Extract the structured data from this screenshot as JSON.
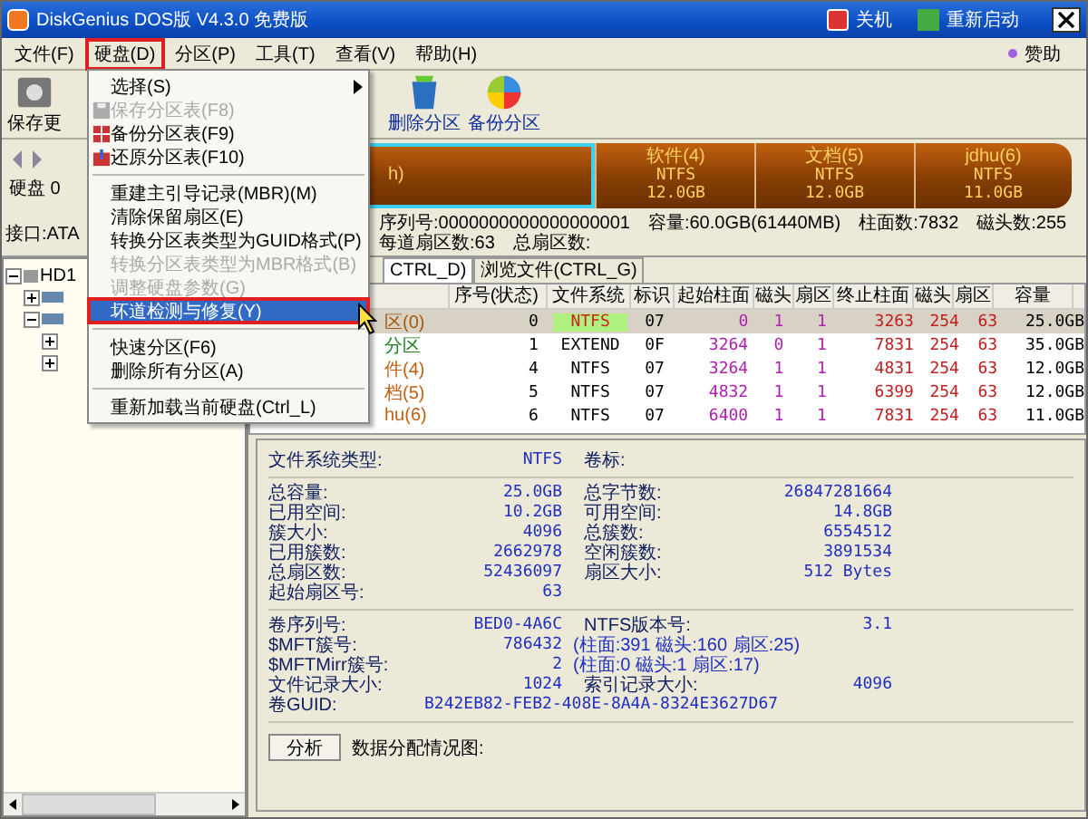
{
  "window": {
    "title": "DiskGenius DOS版 V4.3.0 免费版",
    "actions": [
      "关机",
      "重新启动"
    ]
  },
  "menu_bar": {
    "items": [
      {
        "label": "文件(F)",
        "selected": false
      },
      {
        "label": "硬盘(D)",
        "selected": true
      },
      {
        "label": "分区(P)",
        "selected": false
      },
      {
        "label": "工具(T)",
        "selected": false
      },
      {
        "label": "查看(V)",
        "selected": false
      },
      {
        "label": "帮助(H)",
        "selected": false
      }
    ],
    "sponsor": "赞助"
  },
  "toolbar": {
    "left_button": "保存更",
    "buttons": [
      "删除分区",
      "备份分区"
    ]
  },
  "disk_panel": {
    "label": "硬盘 0",
    "partitions": [
      {
        "name": "h)",
        "selected": true
      },
      {
        "name": "软件(4)",
        "fs": "NTFS",
        "size": "12.0GB",
        "selected": false
      },
      {
        "name": "文档(5)",
        "fs": "NTFS",
        "size": "12.0GB",
        "selected": false
      },
      {
        "name": "jdhu(6)",
        "fs": "NTFS",
        "size": "11.0GB",
        "selected": false
      }
    ]
  },
  "info_line": [
    "接口:ATA",
    "序列号:0000000000000000001",
    "容量:60.0GB(61440MB)",
    "柱面数:7832",
    "磁头数:255",
    "每道扇区数:63",
    "总扇区数:"
  ],
  "tree": [
    {
      "label": "HD1",
      "expanded": true,
      "children": [
        {
          "expanded": false
        },
        {
          "expanded": true,
          "children": [
            {
              "expanded": false
            },
            {
              "expanded": false
            }
          ]
        }
      ]
    }
  ],
  "tabs": [
    {
      "label": "CTRL_D)",
      "selected": true
    },
    {
      "label": "浏览文件(CTRL_G)",
      "selected": false
    }
  ],
  "table": {
    "columns": [
      "",
      "序号(状态)",
      "文件系统",
      "标识",
      "起始柱面",
      "磁头",
      "扇区",
      "终止柱面",
      "磁头",
      "扇区",
      "容量"
    ],
    "rows": [
      {
        "selected": true,
        "color": "#a05a10",
        "cells": [
          "区(0)",
          "0",
          "NTFS",
          "07",
          "0",
          "1",
          "1",
          "3263",
          "254",
          "63",
          "25.0GB"
        ]
      },
      {
        "selected": false,
        "color": "#208020",
        "cells": [
          "分区",
          "1",
          "EXTEND",
          "0F",
          "3264",
          "0",
          "1",
          "7831",
          "254",
          "63",
          "35.0GB"
        ]
      },
      {
        "selected": false,
        "color": "#c06010",
        "cells": [
          "件(4)",
          "4",
          "NTFS",
          "07",
          "3264",
          "1",
          "1",
          "4831",
          "254",
          "63",
          "12.0GB"
        ]
      },
      {
        "selected": false,
        "color": "#c06010",
        "cells": [
          "档(5)",
          "5",
          "NTFS",
          "07",
          "4832",
          "1",
          "1",
          "6399",
          "254",
          "63",
          "12.0GB"
        ]
      },
      {
        "selected": false,
        "color": "#c06010",
        "cells": [
          "hu(6)",
          "6",
          "NTFS",
          "07",
          "6400",
          "1",
          "1",
          "7831",
          "254",
          "63",
          "11.0GB"
        ]
      }
    ]
  },
  "details": {
    "groups": [
      [
        {
          "kind": "pair",
          "label": "文件系统类型:",
          "value": "NTFS",
          "label2": "卷标:"
        }
      ],
      [
        {
          "kind": "pair",
          "label": "总容量:",
          "value": "25.0GB",
          "label2": "总字节数:",
          "value2": "26847281664"
        },
        {
          "kind": "pair",
          "label": "已用空间:",
          "value": "10.2GB",
          "label2": "可用空间:",
          "value2": "14.8GB"
        },
        {
          "kind": "pair",
          "label": "簇大小:",
          "value": "4096",
          "label2": "总簇数:",
          "value2": "6554512"
        },
        {
          "kind": "pair",
          "label": "已用簇数:",
          "value": "2662978",
          "label2": "空闲簇数:",
          "value2": "3891534"
        },
        {
          "kind": "pair",
          "label": "总扇区数:",
          "value": "52436097",
          "label2": "扇区大小:",
          "value2": "512 Bytes"
        },
        {
          "kind": "pair",
          "label": "起始扇区号:",
          "value": "63"
        }
      ],
      [
        {
          "kind": "pair",
          "label": "卷序列号:",
          "value": "BED0-4A6C",
          "label2": "NTFS版本号:",
          "value2": "3.1"
        },
        {
          "kind": "note",
          "label": "$MFT簇号:",
          "value": "786432",
          "note": "(柱面:391 磁头:160 扇区:25)"
        },
        {
          "kind": "note",
          "label": "$MFTMirr簇号:",
          "value": "2",
          "note": "(柱面:0 磁头:1 扇区:17)"
        },
        {
          "kind": "pair",
          "label": "文件记录大小:",
          "value": "1024",
          "label2": "索引记录大小:",
          "value2": "4096"
        },
        {
          "kind": "span",
          "label": "卷GUID:",
          "value": "B242EB82-FEB2-408E-8A4A-8324E3627D67"
        }
      ]
    ],
    "analyze_button": "分析",
    "chart_label": "数据分配情况图:"
  },
  "dropdown": {
    "items": [
      {
        "kind": "item",
        "label": "选择(S)",
        "submenu": true,
        "disabled": false,
        "selected": false
      },
      {
        "kind": "item",
        "label": "保存分区表(F8)",
        "submenu": false,
        "disabled": true,
        "selected": false
      },
      {
        "kind": "item",
        "label": "备份分区表(F9)",
        "submenu": false,
        "disabled": false,
        "selected": false
      },
      {
        "kind": "item",
        "label": "还原分区表(F10)",
        "submenu": false,
        "disabled": false,
        "selected": false
      },
      {
        "kind": "sep"
      },
      {
        "kind": "item",
        "label": "重建主引导记录(MBR)(M)",
        "submenu": false,
        "disabled": false,
        "selected": false
      },
      {
        "kind": "item",
        "label": "清除保留扇区(E)",
        "submenu": false,
        "disabled": false,
        "selected": false
      },
      {
        "kind": "item",
        "label": "转换分区表类型为GUID格式(P)",
        "submenu": false,
        "disabled": false,
        "selected": false
      },
      {
        "kind": "item",
        "label": "转换分区表类型为MBR格式(B)",
        "submenu": false,
        "disabled": true,
        "selected": false
      },
      {
        "kind": "item",
        "label": "调整硬盘参数(G)",
        "submenu": false,
        "disabled": true,
        "selected": false
      },
      {
        "kind": "item",
        "label": "坏道检测与修复(Y)",
        "submenu": false,
        "disabled": false,
        "selected": true
      },
      {
        "kind": "sep"
      },
      {
        "kind": "item",
        "label": "快速分区(F6)",
        "submenu": false,
        "disabled": false,
        "selected": false
      },
      {
        "kind": "item",
        "label": "删除所有分区(A)",
        "submenu": false,
        "disabled": false,
        "selected": false
      },
      {
        "kind": "sep"
      },
      {
        "kind": "item",
        "label": "重新加载当前硬盘(Ctrl_L)",
        "submenu": false,
        "disabled": false,
        "selected": false
      }
    ]
  }
}
